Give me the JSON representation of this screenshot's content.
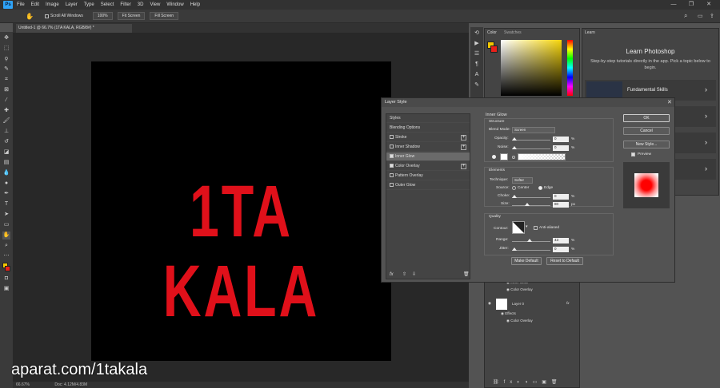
{
  "menubar": {
    "logo": "Ps",
    "items": [
      "File",
      "Edit",
      "Image",
      "Layer",
      "Type",
      "Select",
      "Filter",
      "3D",
      "View",
      "Window",
      "Help"
    ],
    "window_controls": [
      "—",
      "❐",
      "✕"
    ]
  },
  "options_bar": {
    "scroll_all_label": "Scroll All Windows",
    "zoom_value": "100%",
    "fit_screen": "Fit Screen",
    "fill_screen": "Fill Screen"
  },
  "document": {
    "tab_title": "Untitled-1 @ 66.7% (1TA KALA, RGB/8#) *",
    "canvas_text": "1TA KALA",
    "zoom_status": "66.67%",
    "doc_status": "Doc: 4.12M/4.83M"
  },
  "color_panel": {
    "tabs": [
      "Color",
      "Swatches"
    ]
  },
  "learn_panel": {
    "tab": "Learn",
    "title": "Learn Photoshop",
    "subtitle": "Step-by-step tutorials directly in the app. Pick a topic below to begin.",
    "items": [
      {
        "label": "Fundamental Skills"
      },
      {
        "label": ""
      },
      {
        "label": "ts"
      },
      {
        "label": ""
      }
    ]
  },
  "layer_style_dialog": {
    "title": "Layer Style",
    "styles_list": [
      {
        "label": "Styles",
        "checked": null,
        "plus": false
      },
      {
        "label": "Blending Options",
        "checked": null,
        "plus": false
      },
      {
        "label": "Stroke",
        "checked": false,
        "plus": true
      },
      {
        "label": "Inner Shadow",
        "checked": false,
        "plus": true
      },
      {
        "label": "Inner Glow",
        "checked": true,
        "plus": false
      },
      {
        "label": "Color Overlay",
        "checked": true,
        "plus": true
      },
      {
        "label": "Pattern Overlay",
        "checked": false,
        "plus": false
      },
      {
        "label": "Outer Glow",
        "checked": false,
        "plus": false
      }
    ],
    "section_title": "Inner Glow",
    "structure": {
      "title": "Structure",
      "blend_mode_label": "Blend Mode:",
      "blend_mode_value": "Screen",
      "opacity_label": "Opacity:",
      "opacity_value": "0",
      "noise_label": "Noise:",
      "noise_value": "0",
      "percent": "%"
    },
    "elements": {
      "title": "Elements",
      "technique_label": "Technique:",
      "technique_value": "Softer",
      "source_label": "Source:",
      "center_label": "Center",
      "edge_label": "Edge",
      "choke_label": "Choke:",
      "choke_value": "0",
      "size_label": "Size:",
      "size_value": "80",
      "px": "px"
    },
    "quality": {
      "title": "Quality",
      "contour_label": "Contour:",
      "anti_aliased_label": "Anti-aliased",
      "range_label": "Range:",
      "range_value": "43",
      "jitter_label": "Jitter:",
      "jitter_value": "0"
    },
    "make_default": "Make Default",
    "reset_default": "Reset to Default",
    "ok": "OK",
    "cancel": "Cancel",
    "new_style": "New Style...",
    "preview_label": "Preview",
    "fx_label": "fx"
  },
  "layers_panel": {
    "rows": [
      {
        "label": "Inner Glow"
      },
      {
        "label": "Color Overlay"
      },
      {
        "label": "Layer 0"
      },
      {
        "label": "Effects"
      },
      {
        "label": "Color Overlay"
      }
    ],
    "fx": "fx"
  },
  "watermark": "aparat.com/1takala",
  "colors": {
    "text_red": "#e0101a",
    "canvas_black": "#000000",
    "app_bg": "#535353"
  }
}
